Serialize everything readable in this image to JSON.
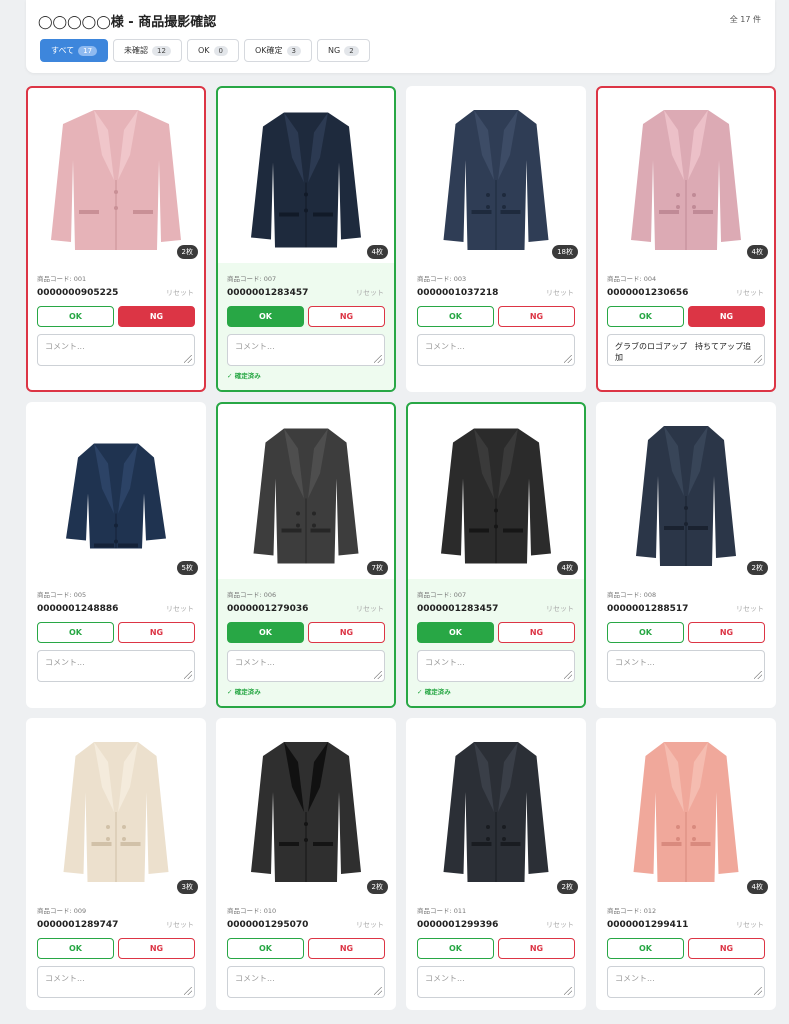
{
  "header": {
    "title": "◯◯◯◯◯様 - 商品撮影確認",
    "total": "全 17 件",
    "tabs": [
      {
        "label": "すべて",
        "count": "17"
      },
      {
        "label": "未確認",
        "count": "12"
      },
      {
        "label": "OK",
        "count": "0"
      },
      {
        "label": "OK確定",
        "count": "3"
      },
      {
        "label": "NG",
        "count": "2"
      }
    ]
  },
  "labels": {
    "ok": "OK",
    "ng": "NG",
    "reset": "リセット",
    "comment_placeholder": "コメント...",
    "confirmed": "✓ 確定済み"
  },
  "colors": {
    "ok": "#28a745",
    "ng": "#dc3545",
    "accent": "#3d86dc"
  },
  "cards": [
    {
      "code": "商品コード: 001",
      "jan": "0000000905225",
      "photos": "2枚",
      "status": "ng",
      "comment": ""
    },
    {
      "code": "商品コード: 007",
      "jan": "0000001283457",
      "photos": "4枚",
      "status": "confirmed",
      "comment": ""
    },
    {
      "code": "商品コード: 003",
      "jan": "0000001037218",
      "photos": "18枚",
      "status": "none",
      "comment": ""
    },
    {
      "code": "商品コード: 004",
      "jan": "0000001230656",
      "photos": "4枚",
      "status": "ng",
      "comment": "グラブのロゴアップ　持ちてアップ追加"
    },
    {
      "code": "商品コード: 005",
      "jan": "0000001248886",
      "photos": "5枚",
      "status": "none",
      "comment": ""
    },
    {
      "code": "商品コード: 006",
      "jan": "0000001279036",
      "photos": "7枚",
      "status": "confirmed",
      "comment": ""
    },
    {
      "code": "商品コード: 007",
      "jan": "0000001283457",
      "photos": "4枚",
      "status": "confirmed",
      "comment": ""
    },
    {
      "code": "商品コード: 008",
      "jan": "0000001288517",
      "photos": "2枚",
      "status": "none",
      "comment": ""
    },
    {
      "code": "商品コード: 009",
      "jan": "0000001289747",
      "photos": "3枚",
      "status": "none",
      "comment": ""
    },
    {
      "code": "商品コード: 010",
      "jan": "0000001295070",
      "photos": "2枚",
      "status": "none",
      "comment": ""
    },
    {
      "code": "商品コード: 011",
      "jan": "0000001299396",
      "photos": "2枚",
      "status": "none",
      "comment": ""
    },
    {
      "code": "商品コード: 012",
      "jan": "0000001299411",
      "photos": "4枚",
      "status": "none",
      "comment": ""
    }
  ]
}
